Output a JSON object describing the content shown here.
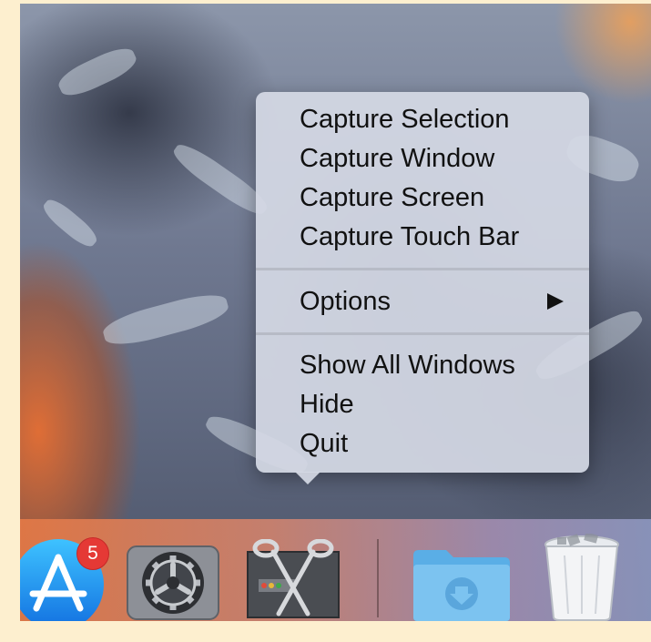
{
  "menu": {
    "capture_items": [
      {
        "label": "Capture Selection"
      },
      {
        "label": "Capture Window"
      },
      {
        "label": "Capture Screen"
      },
      {
        "label": "Capture Touch Bar"
      }
    ],
    "options_label": "Options",
    "window_items": [
      {
        "label": "Show All Windows"
      },
      {
        "label": "Hide"
      },
      {
        "label": "Quit"
      }
    ]
  },
  "dock": {
    "app_store": {
      "icon": "app-store-icon",
      "badge": "5"
    },
    "system_preferences": {
      "icon": "system-preferences-icon"
    },
    "screenshot_app": {
      "icon": "scissors-icon"
    },
    "downloads": {
      "icon": "downloads-folder-icon"
    },
    "trash": {
      "icon": "trash-icon"
    }
  },
  "colors": {
    "menu_bg": "#d4d8e4",
    "badge": "#e53935",
    "folder": "#7cc3f0"
  }
}
